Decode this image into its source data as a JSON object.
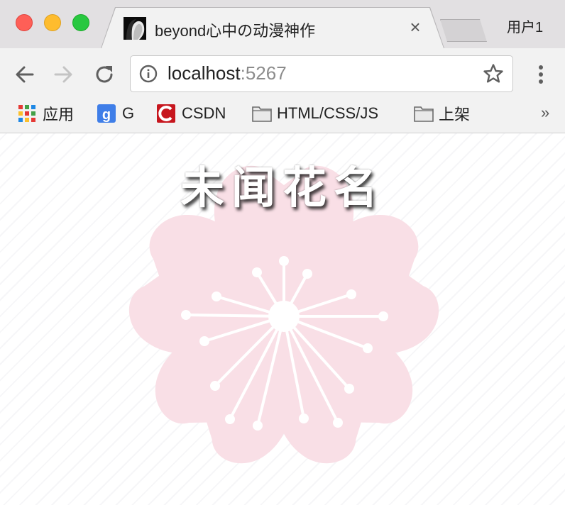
{
  "window": {
    "profile_name": "用户1"
  },
  "tab": {
    "title": "beyond心中の动漫神作",
    "close_glyph": "×"
  },
  "address_bar": {
    "host": "localhost",
    "port": ":5267"
  },
  "bookmarks": {
    "items": [
      {
        "label": "应用",
        "icon": "apps-grid-icon"
      },
      {
        "label": "G",
        "icon": "google-icon"
      },
      {
        "label": "CSDN",
        "icon": "csdn-icon"
      },
      {
        "label": "HTML/CSS/JS",
        "icon": "folder-icon"
      },
      {
        "label": "上架",
        "icon": "folder-icon"
      }
    ],
    "more_glyph": "»"
  },
  "page": {
    "heading": "未闻花名"
  },
  "colors": {
    "blossom": "#f9dfe6",
    "accent_link": "#222222"
  }
}
